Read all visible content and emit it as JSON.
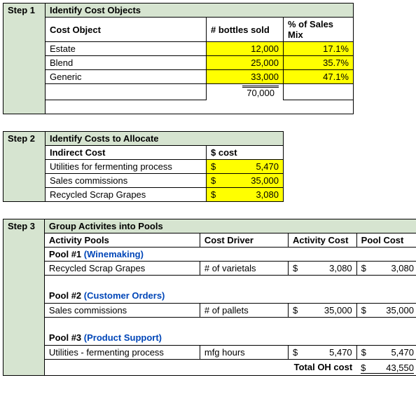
{
  "step1": {
    "label": "Step 1",
    "title": "Identify Cost Objects",
    "cols": {
      "obj": "Cost Object",
      "bottles": "# bottles sold",
      "mix": "% of Sales Mix"
    },
    "rows": [
      {
        "obj": "Estate",
        "bottles": "12,000",
        "mix": "17.1%"
      },
      {
        "obj": "Blend",
        "bottles": "25,000",
        "mix": "35.7%"
      },
      {
        "obj": "Generic",
        "bottles": "33,000",
        "mix": "47.1%"
      }
    ],
    "total": "70,000"
  },
  "step2": {
    "label": "Step 2",
    "title": "Identify Costs to Allocate",
    "cols": {
      "name": "Indirect Cost",
      "cost": "$ cost"
    },
    "rows": [
      {
        "name": "Utilities for fermenting process",
        "sym": "$",
        "val": "5,470"
      },
      {
        "name": "Sales commissions",
        "sym": "$",
        "val": "35,000"
      },
      {
        "name": "Recycled Scrap Grapes",
        "sym": "$",
        "val": "3,080"
      }
    ]
  },
  "step3": {
    "label": "Step 3",
    "title": "Group Activites into Pools",
    "cols": {
      "pool": "Activity Pools",
      "driver": "Cost Driver",
      "act": "Activity Cost",
      "pcost": "Pool Cost"
    },
    "pool1": {
      "hdr": "Pool #1",
      "name": "(Winemaking)",
      "item": "Recycled Scrap Grapes",
      "driver": "# of varietals",
      "sym": "$",
      "act": "3,080",
      "pcost": "3,080"
    },
    "pool2": {
      "hdr": "Pool #2",
      "name": "(Customer Orders)",
      "item": "Sales commissions",
      "driver": "# of pallets",
      "sym": "$",
      "act": "35,000",
      "pcost": "35,000"
    },
    "pool3": {
      "hdr": "Pool #3",
      "name": "(Product Support)",
      "item": "Utilities - fermenting process",
      "driver": "mfg hours",
      "sym": "$",
      "act": "5,470",
      "pcost": "5,470"
    },
    "total_label": "Total OH cost",
    "total_sym": "$",
    "total_val": "43,550"
  }
}
